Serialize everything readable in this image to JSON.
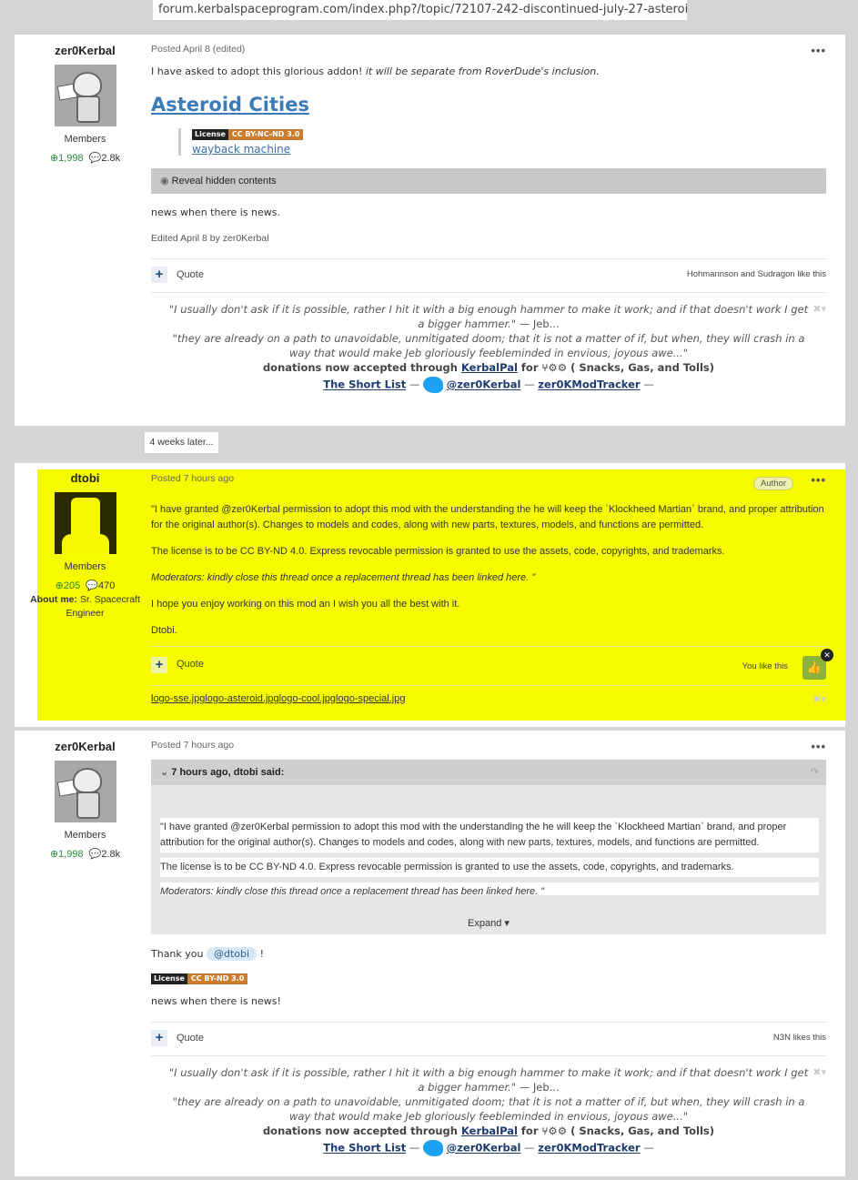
{
  "browser": {
    "url": "forum.kerbalspaceprogram.com/index.php?/topic/72107-242-discontinued-july-27-asteroi..."
  },
  "post1": {
    "username": "zer0Kerbal",
    "group": "Members",
    "rep": "1,998",
    "posts": "2.8k",
    "meta": "Posted April 8 (edited)",
    "intro": "I have asked to adopt this glorious addon!",
    "intro_italic": "it will be separate from RoverDude's inclusion.",
    "heading": "Asteroid Cities",
    "license_a": "License",
    "license_b": "CC BY-NC-ND 3.0",
    "wayback": "wayback machine",
    "spoiler": "Reveal hidden contents",
    "news": "news when there is news.",
    "edited": "Edited April 8 by zer0Kerbal",
    "quote": "Quote",
    "likes": "Hohmannson and Sudragon like this"
  },
  "signature": {
    "line1": "\"I usually don't ask if it is possible, rather I hit it with a big enough hammer to make it work; and if that doesn't work I get a bigger hammer.\"",
    "jeb": " — Jeb...",
    "line2": "\"they are already on a path to unavoidable, unmitigated doom; that it is not a matter of if, but when, they will crash in a way that would make Jeb gloriously feebleminded in envious, joyous awe...\"",
    "donations": "donations now accepted through",
    "kerbalpal": "KerbalPal",
    "for": "for",
    "snacks": "( Snacks, Gas, and Tolls)",
    "shortlist": "The Short List",
    "dash": "—",
    "twitter": "@zer0Kerbal",
    "tracker": "zer0KModTracker"
  },
  "weeks_later": "4 weeks later...",
  "post2": {
    "username": "dtobi",
    "group": "Members",
    "rep": "205",
    "posts": "470",
    "about_label": "About me:",
    "about": "Sr. Spacecraft Engineer",
    "meta": "Posted 7 hours ago",
    "badge": "Author",
    "p1": "\"I have granted @zer0Kerbal permission to adopt this mod with the understanding the he will keep the `Klockheed Martian` brand,  and proper attribution for the original author(s). Changes to models and codes, along with new parts, textures, models, and functions are permitted.",
    "p2": "The license is to be CC BY-ND 4.0. Express revocable permission is granted to use the assets, code, copyrights, and trademarks.",
    "p3": "Moderators: kindly close this thread once a replacement thread has been linked here. \"",
    "p4": "I hope you enjoy working on this mod an I wish you all the best with it.",
    "p5": "Dtobi.",
    "quote": "Quote",
    "likes": "You like this",
    "images": [
      "logo-sse.jpg",
      "logo-asteroid.jpg",
      "logo-cool.jpg",
      "logo-special.jpg"
    ]
  },
  "post3": {
    "username": "zer0Kerbal",
    "group": "Members",
    "rep": "1,998",
    "posts": "2.8k",
    "meta": "Posted 7 hours ago",
    "quote_head": "7 hours ago, dtobi said:",
    "qp1": "\"I have granted @zer0Kerbal permission to adopt this mod with the understanding the he will keep the `Klockheed Martian` brand,  and proper attribution for the original author(s). Changes to models and codes, along with new parts, textures, models, and functions are permitted.",
    "qp2": "The license is to be CC BY-ND 4.0. Express revocable permission is granted to use the assets, code, copyrights, and trademarks.",
    "qp3": "Moderators: kindly close this thread once a replacement thread has been linked here. \"",
    "expand": "Expand",
    "thank": "Thank you",
    "mention": "@dtobi",
    "excl": "!",
    "license_a": "License",
    "license_b": "CC BY-ND 3.0",
    "news": "news when there is news!",
    "quote": "Quote",
    "likes": "N3N likes this"
  },
  "colors": {
    "highlight": "#f7fb00",
    "link": "#3c7ab8",
    "rep": "#2b8a3e"
  }
}
